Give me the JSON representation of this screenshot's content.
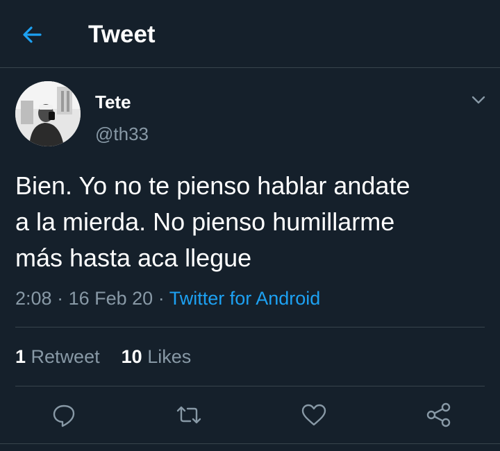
{
  "header": {
    "title": "Tweet",
    "back_icon": "back-arrow-icon"
  },
  "colors": {
    "background": "#15202b",
    "accent": "#1da1f2",
    "secondary_text": "#8899a6",
    "divider": "#38444d"
  },
  "tweet": {
    "author": {
      "display_name": "Tete",
      "handle": "@th33"
    },
    "text_lines": [
      "Bien. Yo no te pienso hablar andate",
      "a la mierda. No pienso humillarme",
      "más hasta aca llegue"
    ],
    "time": "2:08",
    "date": "16 Feb 20",
    "separator": "·",
    "source": "Twitter for Android",
    "stats": {
      "retweets_count": "1",
      "retweets_label": "Retweet",
      "likes_count": "10",
      "likes_label": "Likes"
    }
  },
  "actions": [
    {
      "name": "reply",
      "icon": "reply-bubble-icon"
    },
    {
      "name": "retweet",
      "icon": "retweet-icon"
    },
    {
      "name": "like",
      "icon": "heart-icon"
    },
    {
      "name": "share",
      "icon": "share-icon"
    }
  ]
}
